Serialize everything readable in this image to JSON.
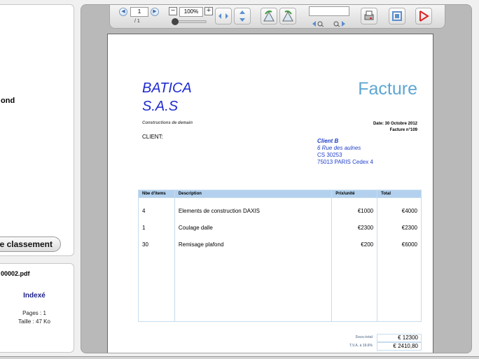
{
  "left_panel": {
    "top_fragment": "ond",
    "classement_button": "e classement",
    "file": {
      "name": "00002.pdf",
      "status": "Indexé",
      "pages": "Pages : 1",
      "size": "Taille : 47 Ko"
    }
  },
  "toolbar": {
    "page_current": "1",
    "page_total": "/ 1",
    "zoom": "100%",
    "zoom_minus": "−",
    "zoom_plus": "+",
    "search_placeholder": ""
  },
  "invoice": {
    "company_line1": "BATICA",
    "company_line2": "S.A.S",
    "tagline": "Constructions de demain",
    "title": "Facture",
    "date": "Date:  30 Octobre 2012",
    "number": "Facture n°109",
    "client_label": "CLIENT:",
    "client": {
      "name": "Client B",
      "street": "6 Rue des aulnes",
      "cs": "CS 30253",
      "city": "75013 PARIS Cedex 4"
    },
    "columns": [
      "Nbe d'items",
      "Description",
      "Prix/unité",
      "Total"
    ],
    "rows": [
      {
        "qty": "4",
        "desc": "Elements de construction DAXIS",
        "unit": "€1000",
        "total": "€4000"
      },
      {
        "qty": "1",
        "desc": "Coulage dalle",
        "unit": "€2300",
        "total": "€2300"
      },
      {
        "qty": "30",
        "desc": "Remisage plafond",
        "unit": "€200",
        "total": "€6000"
      }
    ],
    "totals": [
      {
        "label": "Sous-total",
        "value": "€ 12300"
      },
      {
        "label": "T.V.A. à 19.6%",
        "value": "€ 2410,80"
      }
    ]
  },
  "colors": {
    "company": "#1f2bcf",
    "title": "#5fa6d2",
    "header_row": "#b3d1ee",
    "client": "#1f3fc9"
  }
}
